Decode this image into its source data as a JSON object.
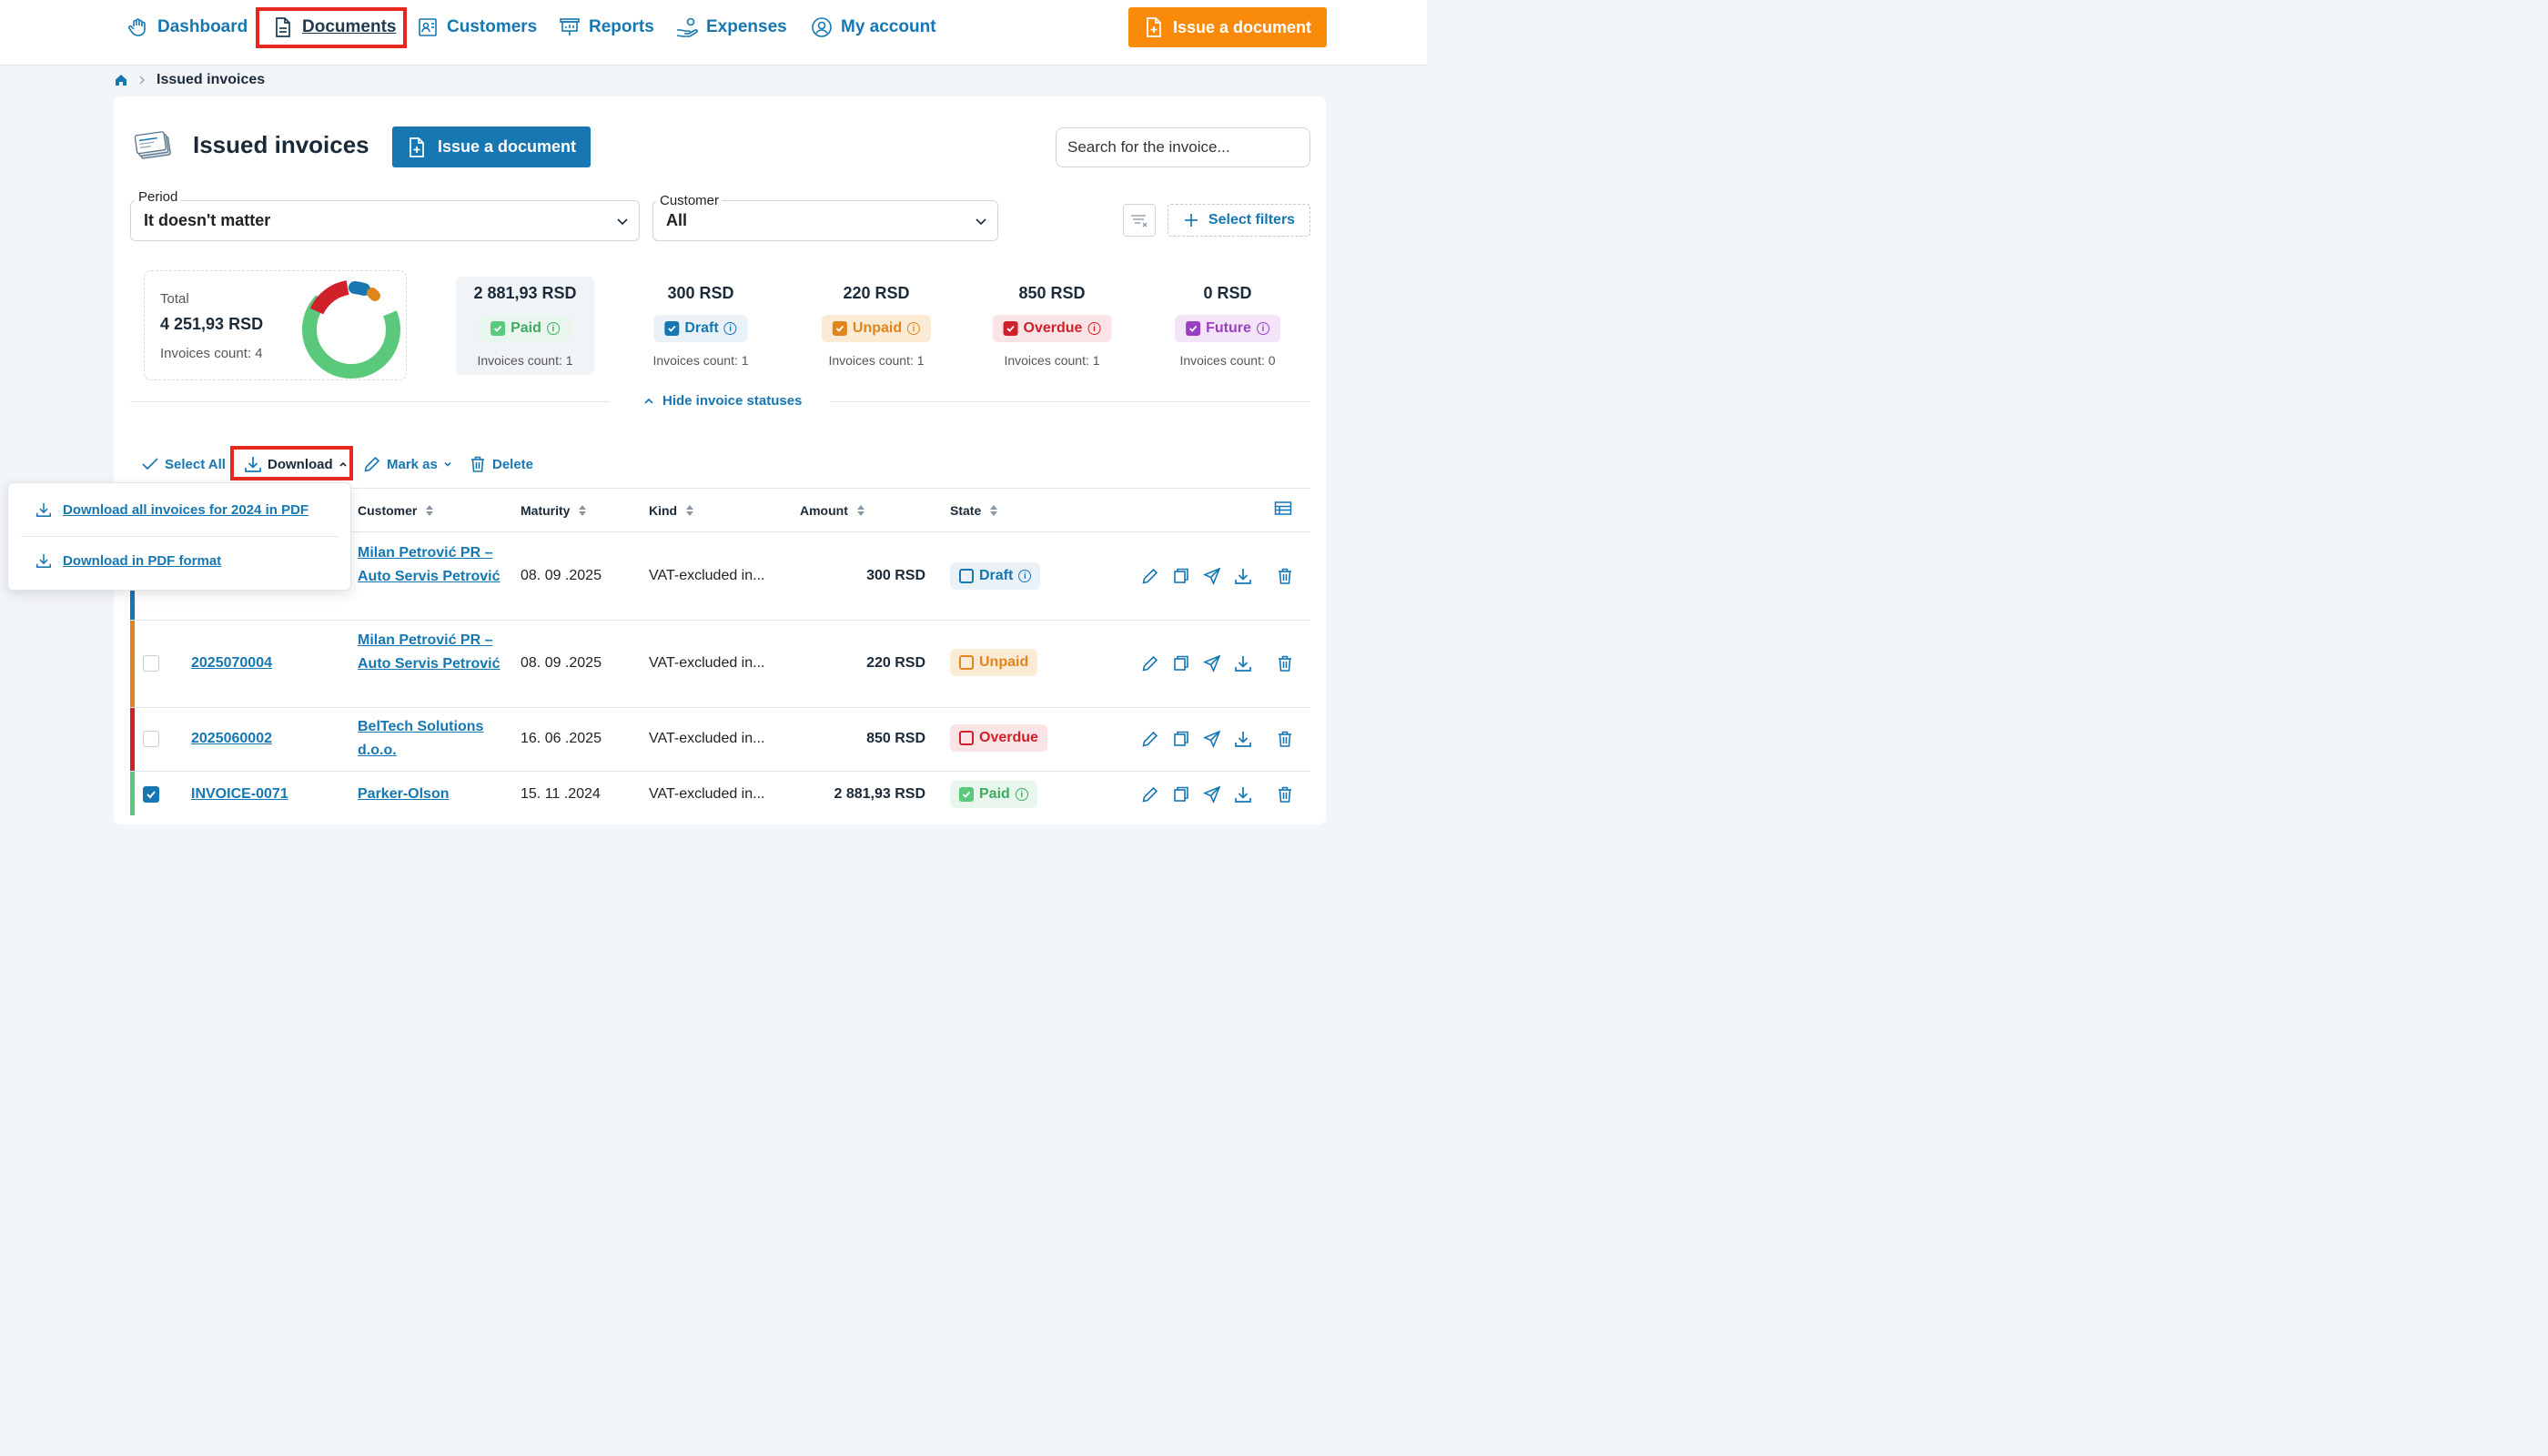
{
  "nav": {
    "dashboard": "Dashboard",
    "documents": "Documents",
    "customers": "Customers",
    "reports": "Reports",
    "expenses": "Expenses",
    "my_account": "My account",
    "issue_button": "Issue a document"
  },
  "breadcrumb": {
    "current": "Issued invoices"
  },
  "header": {
    "title": "Issued invoices",
    "issue_button": "Issue a document",
    "search_placeholder": "Search for the invoice..."
  },
  "filters": {
    "period_label": "Period",
    "period_value": "It doesn't matter",
    "customer_label": "Customer",
    "customer_value": "All",
    "select_filters": "Select filters"
  },
  "summary": {
    "total_label": "Total",
    "total_value": "4 251,93 RSD",
    "total_count": "Invoices count: 4",
    "stats": [
      {
        "amount": "2 881,93 RSD",
        "label": "Paid",
        "count": "Invoices count: 1"
      },
      {
        "amount": "300 RSD",
        "label": "Draft",
        "count": "Invoices count: 1"
      },
      {
        "amount": "220 RSD",
        "label": "Unpaid",
        "count": "Invoices count: 1"
      },
      {
        "amount": "850 RSD",
        "label": "Overdue",
        "count": "Invoices count: 1"
      },
      {
        "amount": "0 RSD",
        "label": "Future",
        "count": "Invoices count: 0"
      }
    ],
    "hide_statuses": "Hide invoice statuses"
  },
  "toolbar": {
    "select_all": "Select All",
    "download": "Download",
    "mark_as": "Mark as",
    "delete": "Delete"
  },
  "download_menu": {
    "items": [
      "Download all invoices for 2024 in PDF",
      "Download in PDF format"
    ]
  },
  "table": {
    "columns": {
      "customer": "Customer",
      "maturity": "Maturity",
      "kind": "Kind",
      "amount": "Amount",
      "state": "State"
    },
    "rows": [
      {
        "number": "",
        "customer": "Milan Petrović PR – Auto Servis Petrović",
        "maturity": "08. 09 .2025",
        "kind": "VAT-excluded in...",
        "amount": "300 RSD",
        "state": "Draft"
      },
      {
        "number": "2025070004",
        "customer": "Milan Petrović PR – Auto Servis Petrović",
        "maturity": "08. 09 .2025",
        "kind": "VAT-excluded in...",
        "amount": "220 RSD",
        "state": "Unpaid"
      },
      {
        "number": "2025060002",
        "customer": "BelTech Solutions d.o.o.",
        "maturity": "16. 06 .2025",
        "kind": "VAT-excluded in...",
        "amount": "850 RSD",
        "state": "Overdue"
      },
      {
        "number": "INVOICE-0071",
        "customer": "Parker-Olson",
        "maturity": "15. 11 .2024",
        "kind": "VAT-excluded in...",
        "amount": "2 881,93 RSD",
        "state": "Paid"
      }
    ]
  },
  "colors": {
    "primary": "#1677b3",
    "accent_orange": "#f98a0a",
    "paid": "#5bc97b",
    "draft": "#1677b3",
    "unpaid": "#e0851b",
    "overdue": "#d0202a",
    "future": "#9b3fc2",
    "highlight": "#e8281e"
  }
}
